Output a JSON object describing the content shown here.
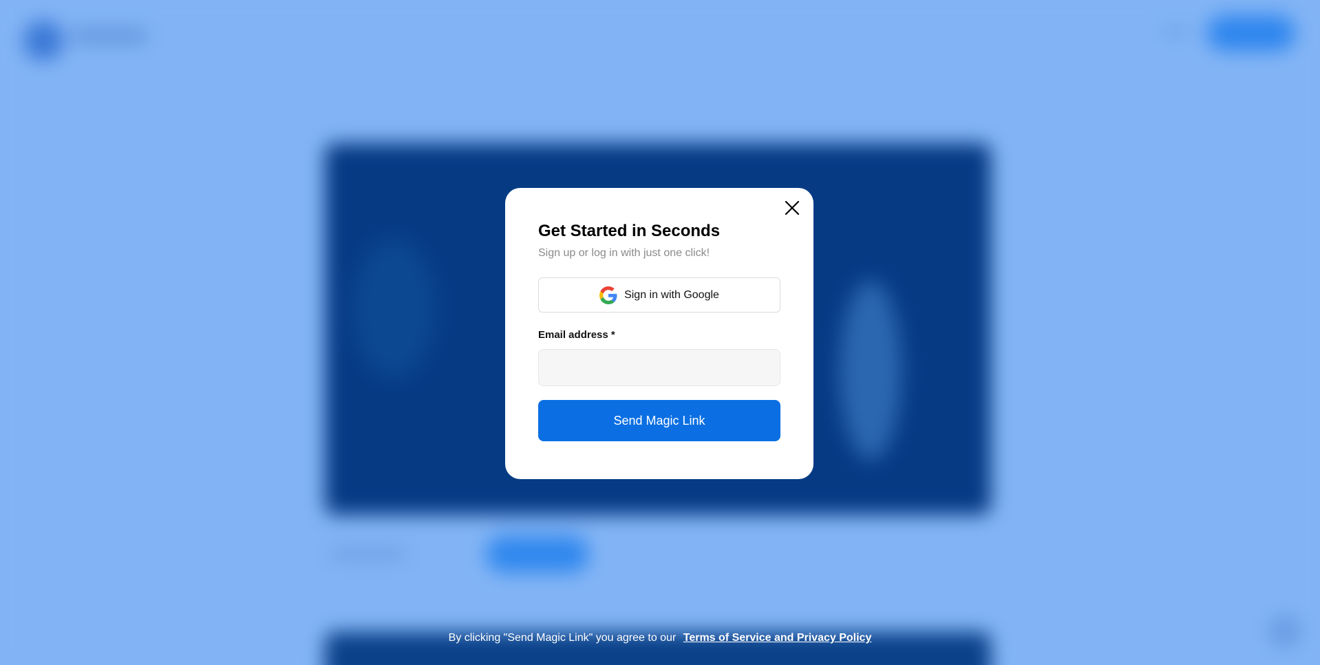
{
  "modal": {
    "title": "Get Started in Seconds",
    "subtitle": "Sign up or log in with just one click!",
    "google_button_label": "Sign in with Google",
    "email_label": "Email address *",
    "email_value": "",
    "email_placeholder": "",
    "send_button_label": "Send Magic Link",
    "close_icon": "close-icon",
    "google_icon": "google-logo-icon"
  },
  "footer": {
    "terms_text": "By clicking \"Send Magic Link\" you agree to our",
    "terms_link": "Terms of Service and Privacy Policy"
  },
  "colors": {
    "backdrop": "#82b4f5",
    "primary_button": "#0b6fe3",
    "modal_background": "#ffffff"
  }
}
